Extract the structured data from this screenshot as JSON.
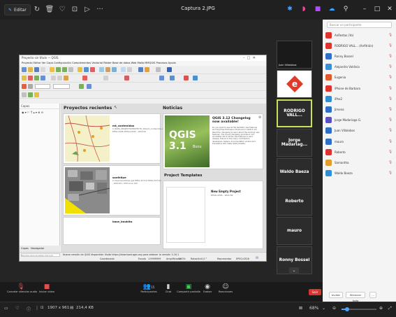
{
  "viewer": {
    "edit_label": "Editar",
    "title": "Captura 2.JPG",
    "more": "···",
    "dimensions": "1907 x 961",
    "size": "214,4 KB",
    "zoom": "68%"
  },
  "qgis": {
    "window_title": "Proyecto sin título — QGIS",
    "menu": [
      "Proyecto",
      "Editar",
      "Ver",
      "Capa",
      "Configuración",
      "Complementos",
      "Vectorial",
      "Ráster",
      "Base de datos",
      "Web",
      "Malla",
      "MMQGIS",
      "Procesos",
      "Ayuda"
    ],
    "panel_title": "Capas",
    "recent_title": "Proyectos recientes",
    "news_title": "Noticias",
    "projects": [
      {
        "name": "mt_contenidos",
        "meta": "C:\\DATA_PROJECTS\\PROYECTO_SIG\\mt_contenidos.qgz   EPSG:4326 (EPSG:4326) - WGS 84"
      },
      {
        "name": "sanfelipe",
        "meta": "C:\\Users\\sanfelipe.qgz   EPSG:32719 (EPSG:32719) - WGS 84 / UTM zone 19S"
      },
      {
        "name": "base_boubita",
        "meta": ""
      }
    ],
    "news_heading": "QGIS 3.12 Changelog now available!",
    "news_body": "Do you want to see all the fantastic new features and bug fixes that were introduced in QGIS 3.12? Read the changelog to learn about the exciting new features. The visual changelog provides a rich, annotated list of all the new features in each release, thanks to the many contributors, developers, testers, documentation writers and translators who make QGIS possible.",
    "news_image_text": "QGIS 3.1",
    "news_image_sub": "Bucu",
    "templates_title": "Project Templates",
    "new_project_title": "New Empty Project",
    "new_project_meta": "EPSG:4326 - WGS 84",
    "left_tabs": [
      "Capas",
      "Navegador"
    ],
    "status_search": "Escribe para localizar (Ctrl+K)",
    "status_msg": "Nueva versión de QGIS disponible: Visite https://download.qgis.org para obtener la versión 3.16.1",
    "status_coord_label": "Coordenada",
    "status_scale_label": "Escala",
    "status_scale": "1:9999999",
    "status_mag_label": "Amplificador",
    "status_mag": "100%",
    "status_rot_label": "Rotación",
    "status_rot": "0,0 °",
    "status_render": "Representar",
    "status_crs": "EPSG:4326"
  },
  "tiles": [
    {
      "name": "Juan Villalobos",
      "kind": "video"
    },
    {
      "name": "",
      "kind": "logo"
    },
    {
      "name": "RODRIGO VALL...",
      "kind": "active"
    },
    {
      "name": "Jorge Madariag...",
      "kind": "name"
    },
    {
      "name": "Waldo Baeza",
      "kind": "name"
    },
    {
      "name": "Roberto",
      "kind": "name"
    },
    {
      "name": "mauro",
      "kind": "name"
    },
    {
      "name": "Ronny Bossel",
      "kind": "name"
    }
  ],
  "participants": {
    "search_placeholder": "Buscar un participante",
    "list": [
      {
        "name": "AnRestas (Yo)",
        "color": "#e0332b"
      },
      {
        "name": "RODRIGO VALL... (Anfitrión)",
        "color": "#e0332b"
      },
      {
        "name": "Ronny Bossel",
        "color": "#2f6fc8"
      },
      {
        "name": "Alejandro Valdivia",
        "color": "#3a8fd6"
      },
      {
        "name": "Eugenia",
        "color": "#e05b2b"
      },
      {
        "name": "iPhone de Barbara",
        "color": "#e0332b"
      },
      {
        "name": "iPhe2",
        "color": "#2f8fd6"
      },
      {
        "name": "Jimena",
        "color": "#2f6fc8"
      },
      {
        "name": "Jorge Madariaga G.",
        "color": "#5b4fc8"
      },
      {
        "name": "Juan Villalobos",
        "color": "#2f6fc8"
      },
      {
        "name": "mauro",
        "color": "#2f6fc8"
      },
      {
        "name": "Roberto",
        "color": "#e0332b"
      },
      {
        "name": "Samantha",
        "color": "#e0a02b"
      },
      {
        "name": "Waldo Baeza",
        "color": "#2f8fd6"
      }
    ],
    "invite_label": "Invitar",
    "mute_all_label": "Silenciar todo",
    "more_label": "..."
  },
  "meeting_bar": {
    "audio": "Cancelar silenciar audio",
    "video": "Iniciar video",
    "participants_count": "15",
    "participants": "Participantes",
    "chat": "Chat",
    "share": "Compartir pantalla",
    "record": "Grabar",
    "reactions": "Reacciones",
    "leave": "Salir"
  }
}
